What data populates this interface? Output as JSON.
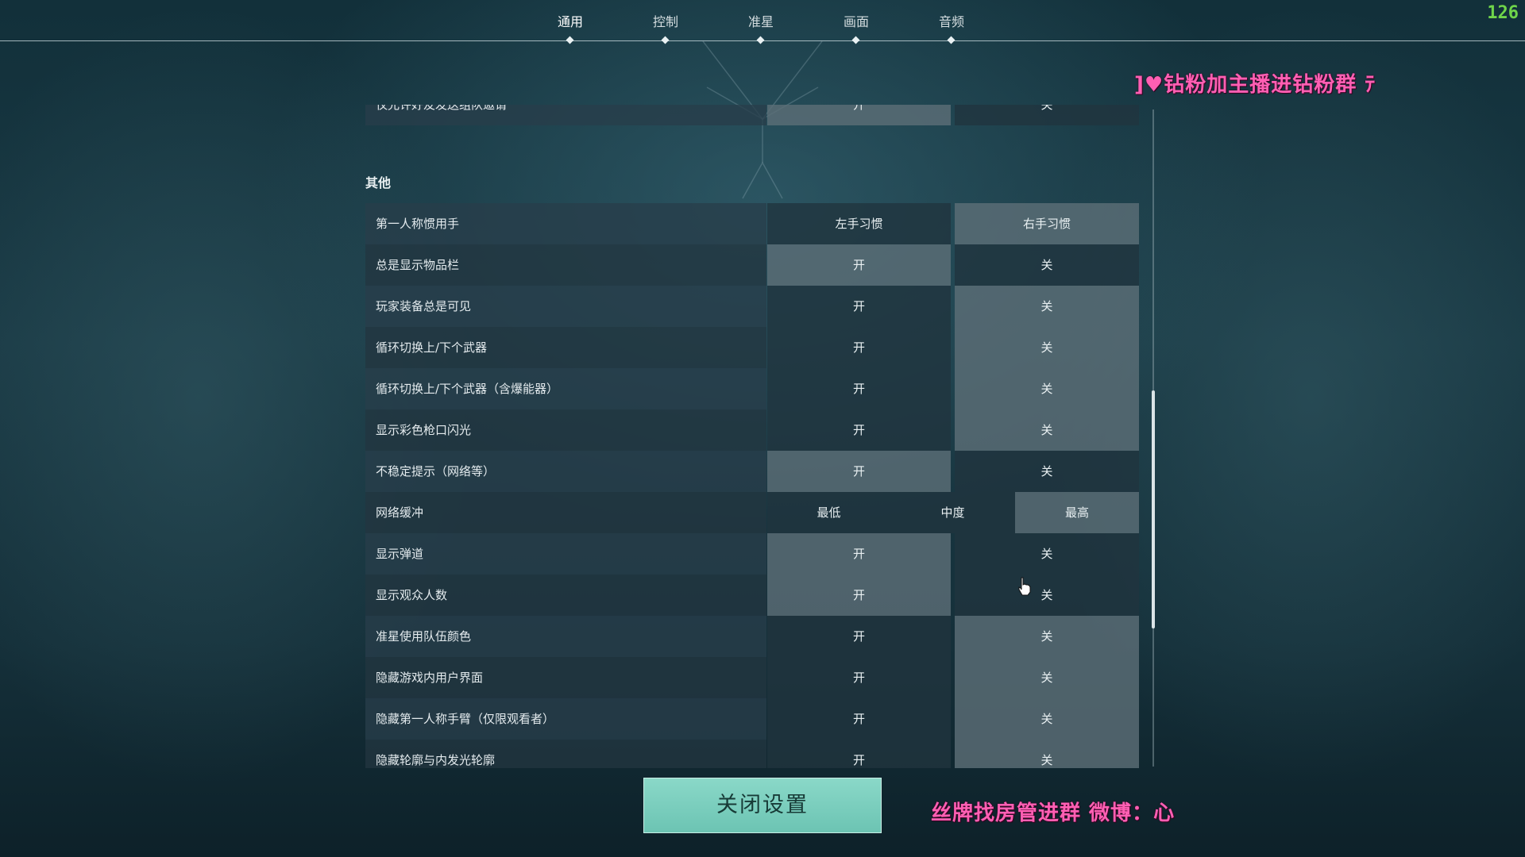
{
  "fps_counter": "126",
  "nav": {
    "tabs": [
      {
        "label": "通用",
        "active": true
      },
      {
        "label": "控制",
        "active": false
      },
      {
        "label": "准星",
        "active": false
      },
      {
        "label": "画面",
        "active": false
      },
      {
        "label": "音频",
        "active": false
      }
    ]
  },
  "stream_overlay": {
    "top_banner": "钻粉加主播进钻粉群",
    "bottom_banner": "丝牌找房管进群  微博："
  },
  "settings": {
    "partial_row": {
      "label": "仅允许好友发送组队邀请",
      "on_label": "开",
      "off_label": "关",
      "selected": "on"
    },
    "section_title": "其他",
    "rows": [
      {
        "label": "第一人称惯用手",
        "options": [
          "左手习惯",
          "右手习惯"
        ],
        "selected": 1
      },
      {
        "label": "总是显示物品栏",
        "options": [
          "开",
          "关"
        ],
        "selected": 0
      },
      {
        "label": "玩家装备总是可见",
        "options": [
          "开",
          "关"
        ],
        "selected": 1
      },
      {
        "label": "循环切换上/下个武器",
        "options": [
          "开",
          "关"
        ],
        "selected": 1
      },
      {
        "label": "循环切换上/下个武器（含爆能器）",
        "options": [
          "开",
          "关"
        ],
        "selected": 1
      },
      {
        "label": "显示彩色枪口闪光",
        "options": [
          "开",
          "关"
        ],
        "selected": 1
      },
      {
        "label": "不稳定提示（网络等）",
        "options": [
          "开",
          "关"
        ],
        "selected": 0
      },
      {
        "label": "网络缓冲",
        "options": [
          "最低",
          "中度",
          "最高"
        ],
        "selected": 2
      },
      {
        "label": "显示弹道",
        "options": [
          "开",
          "关"
        ],
        "selected": 0
      },
      {
        "label": "显示观众人数",
        "options": [
          "开",
          "关"
        ],
        "selected": 0
      },
      {
        "label": "准星使用队伍颜色",
        "options": [
          "开",
          "关"
        ],
        "selected": 1
      },
      {
        "label": "隐藏游戏内用户界面",
        "options": [
          "开",
          "关"
        ],
        "selected": 1
      },
      {
        "label": "隐藏第一人称手臂（仅限观看者）",
        "options": [
          "开",
          "关"
        ],
        "selected": 1
      },
      {
        "label": "隐藏轮廓与内发光轮廓",
        "options": [
          "开",
          "关"
        ],
        "selected": 1
      }
    ]
  },
  "close_button": "关闭设置",
  "colors": {
    "accent_button": "#7ccfbf",
    "selected_option": "#5c6e76",
    "overlay_text": "#ff5fb3",
    "fps_text": "#6fd54a"
  }
}
